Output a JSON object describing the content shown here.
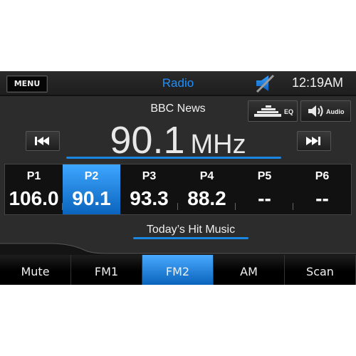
{
  "header": {
    "menu_label": "MENU",
    "title": "Radio",
    "mute_status_icon": "speaker-muted-icon",
    "clock": "12:19AM"
  },
  "station": {
    "name": "BBC News",
    "frequency": "90.1",
    "unit": "MHz",
    "rds_text": "Today’s Hit Music"
  },
  "controls": {
    "eq_label": "EQ",
    "eq_icon": "equalizer-icon",
    "audio_label": "Audio",
    "audio_icon": "speaker-icon",
    "seek_prev_icon": "skip-previous-icon",
    "seek_next_icon": "skip-next-icon"
  },
  "presets": [
    {
      "label": "P1",
      "value": "106.0",
      "selected": false
    },
    {
      "label": "P2",
      "value": "90.1",
      "selected": true
    },
    {
      "label": "P3",
      "value": "93.3",
      "selected": false
    },
    {
      "label": "P4",
      "value": "88.2",
      "selected": false
    },
    {
      "label": "P5",
      "value": "--",
      "selected": false
    },
    {
      "label": "P6",
      "value": "--",
      "selected": false
    }
  ],
  "bottom_tabs": [
    {
      "label": "Mute",
      "selected": false
    },
    {
      "label": "FM1",
      "selected": false
    },
    {
      "label": "FM2",
      "selected": true
    },
    {
      "label": "AM",
      "selected": false
    },
    {
      "label": "Scan",
      "selected": false
    }
  ],
  "colors": {
    "accent": "#1e90ff",
    "selected_top": "#3ea6ff",
    "selected_bottom": "#0a64bd",
    "background": "#2c2c2c"
  }
}
